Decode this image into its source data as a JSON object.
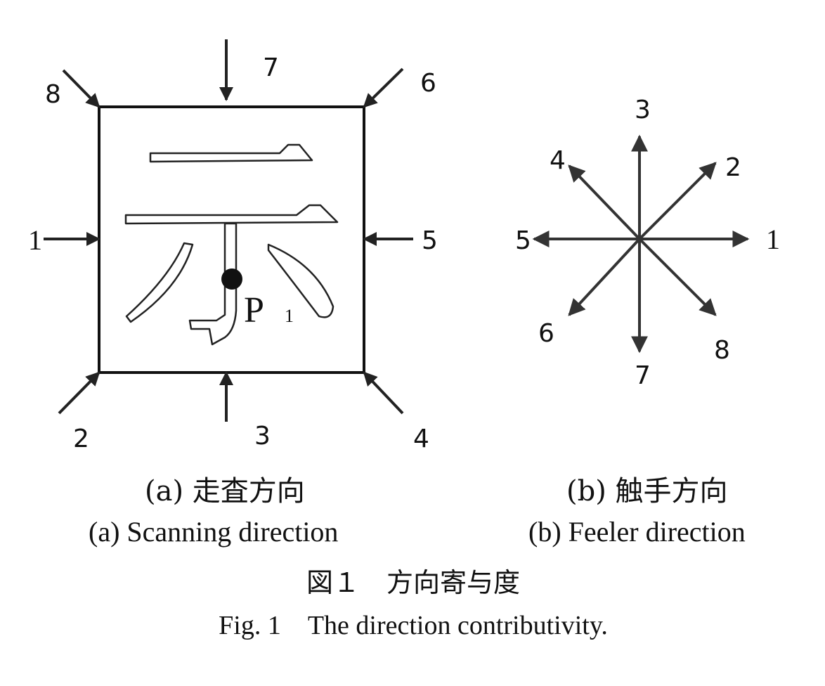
{
  "panel_a": {
    "scan_labels": [
      "1",
      "2",
      "3",
      "4",
      "5",
      "6",
      "7",
      "8"
    ],
    "point_label": "P",
    "point_subscript": "1",
    "caption_jp": "(a) 走査方向",
    "caption_en": "(a) Scanning direction"
  },
  "panel_b": {
    "feeler_labels": [
      "1",
      "2",
      "3",
      "4",
      "5",
      "6",
      "7",
      "8"
    ],
    "caption_jp": "(b) 触手方向",
    "caption_en": "(b) Feeler direction"
  },
  "figure": {
    "caption_jp": "図１　方向寄与度",
    "caption_en": "Fig. 1　The direction contributivity."
  }
}
